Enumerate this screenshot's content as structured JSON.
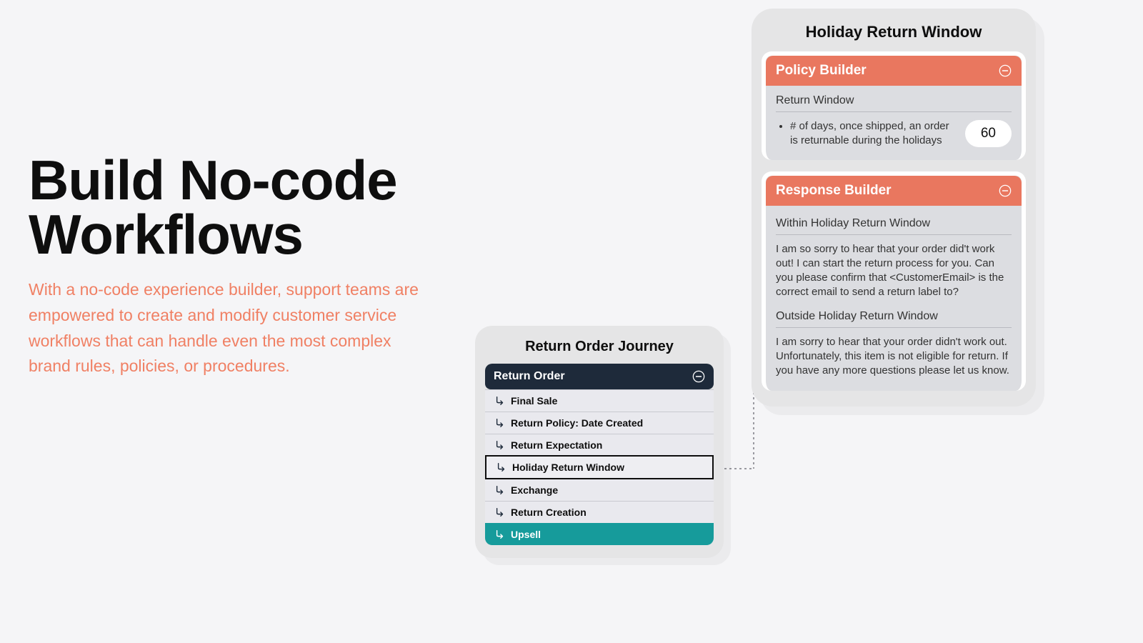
{
  "copy": {
    "heading_line1": "Build No-code",
    "heading_line2": "Workflows",
    "body": "With a no-code experience builder, support teams are empowered to create and modify customer service workflows that can handle even the most complex brand rules, policies, or procedures."
  },
  "journey": {
    "title": "Return Order Journey",
    "header": "Return Order",
    "rows": [
      {
        "label": "Final Sale"
      },
      {
        "label": "Return Policy: Date Created"
      },
      {
        "label": "Return Expectation"
      },
      {
        "label": "Holiday Return Window",
        "selected": true
      },
      {
        "label": "Exchange"
      },
      {
        "label": "Return Creation"
      },
      {
        "label": "Upsell",
        "teal": true
      }
    ]
  },
  "detail": {
    "title": "Holiday Return Window",
    "policy": {
      "header": "Policy Builder",
      "section_label": "Return Window",
      "bullet": "# of days, once shipped, an order is returnable during the holidays",
      "value": "60"
    },
    "response": {
      "header": "Response Builder",
      "within_label": "Within Holiday Return Window",
      "within_text": "I am so sorry to hear that your order did't work out! I can start the return process for you. Can you please confirm that <CustomerEmail> is the correct email to send a return label to?",
      "outside_label": "Outside Holiday Return Window",
      "outside_text": "I am sorry to hear that your order didn't work out.  Unfortunately, this item is not eligible for return. If you have any more questions please let us know."
    }
  }
}
